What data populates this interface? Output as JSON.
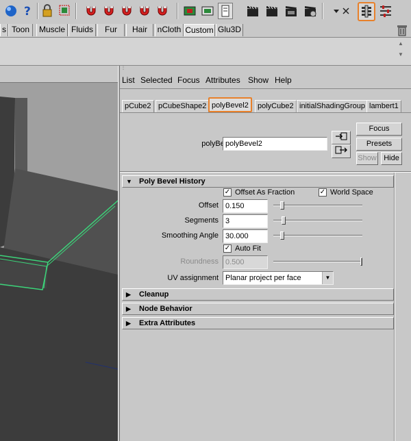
{
  "shelf": {
    "tabs": [
      "s",
      "Toon",
      "Muscle",
      "Fluids",
      "Fur",
      "Hair",
      "nCloth",
      "Custom",
      "Glu3D"
    ],
    "active": "Custom"
  },
  "toolbar": {
    "icons": [
      "sphere-icon",
      "help-icon",
      "lock-icon",
      "select-icon",
      "magnet-icon",
      "magnet-icon",
      "magnet-icon",
      "magnet-icon",
      "magnet-icon",
      "render-view-icon",
      "snapshot-icon",
      "render-icon",
      "clapper-icon",
      "ipr-icon",
      "render-settings-icon",
      "dropdown-icon",
      "close-icon",
      "attribute-editor-icon",
      "tool-settings-icon",
      "trash-icon"
    ]
  },
  "ae": {
    "menu": [
      "List",
      "Selected",
      "Focus",
      "Attributes",
      "Show",
      "Help"
    ],
    "tabs": [
      "pCube2",
      "pCubeShape2",
      "polyBevel2",
      "polyCube2",
      "initialShadingGroup",
      "lambert1"
    ],
    "active_tab": "polyBevel2",
    "node_label": "polyBevel:",
    "node_value": "polyBevel2",
    "buttons": {
      "focus": "Focus",
      "presets": "Presets",
      "show": "Show",
      "hide": "Hide"
    },
    "sections": {
      "poly_bevel_history": "Poly Bevel History",
      "cleanup": "Cleanup",
      "node_behavior": "Node Behavior",
      "extra_attributes": "Extra Attributes"
    },
    "offset_as_fraction": "Offset As Fraction",
    "world_space": "World Space",
    "offset": {
      "label": "Offset",
      "value": "0.150",
      "slider": 0.08
    },
    "segments": {
      "label": "Segments",
      "value": "3",
      "slider": 0.1
    },
    "smoothing_angle": {
      "label": "Smoothing Angle",
      "value": "30.000",
      "slider": 0.08
    },
    "auto_fit": "Auto Fit",
    "roundness": {
      "label": "Roundness",
      "value": "0.500",
      "slider": 1.0
    },
    "uv_assignment": {
      "label": "UV assignment",
      "value": "Planar project per face"
    }
  },
  "colors": {
    "accent": "#e8802a",
    "wire": "#3cd47a",
    "viewport": "#a0a0a0"
  }
}
